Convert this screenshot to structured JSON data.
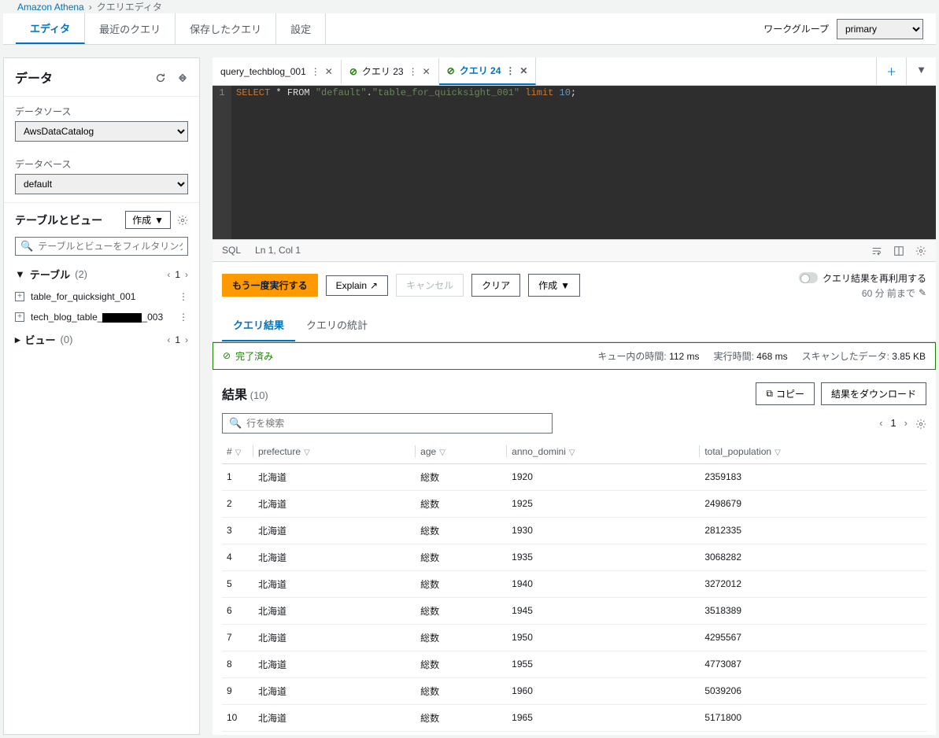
{
  "breadcrumb": {
    "service": "Amazon Athena",
    "page": "クエリエディタ"
  },
  "main_tabs": {
    "editor": "エディタ",
    "recent": "最近のクエリ",
    "saved": "保存したクエリ",
    "settings": "設定"
  },
  "workgroup": {
    "label": "ワークグループ",
    "value": "primary"
  },
  "data_panel": {
    "title": "データ",
    "datasource_label": "データソース",
    "datasource_value": "AwsDataCatalog",
    "database_label": "データベース",
    "database_value": "default",
    "tv_title": "テーブルとビュー",
    "create_btn": "作成",
    "filter_placeholder": "テーブルとビューをフィルタリング",
    "tables_label": "テーブル",
    "tables_count": "(2)",
    "tables_page": "1",
    "table_items": [
      "table_for_quicksight_001",
      "tech_blog_table_",
      "_003"
    ],
    "views_label": "ビュー",
    "views_count": "(0)",
    "views_page": "1"
  },
  "query_tabs": {
    "items": [
      {
        "label": "query_techblog_001",
        "check": false
      },
      {
        "label": "クエリ 23",
        "check": true
      },
      {
        "label": "クエリ 24",
        "check": true
      }
    ]
  },
  "editor": {
    "line_no": "1",
    "sql_select": "SELECT",
    "sql_from": " * FROM ",
    "sql_db": "\"default\"",
    "sql_dot": ".",
    "sql_table": "\"table_for_quicksight_001\"",
    "sql_limit": " limit ",
    "sql_num": "10",
    "sql_semi": ";"
  },
  "statusbar": {
    "lang": "SQL",
    "pos": "Ln 1, Col 1"
  },
  "toolbar": {
    "run": "もう一度実行する",
    "explain": "Explain",
    "cancel": "キャンセル",
    "clear": "クリア",
    "create": "作成",
    "reuse": "クエリ結果を再利用する",
    "reuse_age": "60 分 前まで"
  },
  "result_tabs": {
    "results": "クエリ結果",
    "stats": "クエリの統計"
  },
  "status": {
    "complete": "完了済み",
    "queue_label": "キュー内の時間:",
    "queue_val": "112 ms",
    "run_label": "実行時間:",
    "run_val": "468 ms",
    "scan_label": "スキャンしたデータ:",
    "scan_val": "3.85 KB"
  },
  "results": {
    "title": "結果",
    "count": "(10)",
    "copy": "コピー",
    "download": "結果をダウンロード",
    "filter_placeholder": "行を検索",
    "page": "1",
    "columns": [
      "#",
      "prefecture",
      "age",
      "anno_domini",
      "total_population"
    ],
    "rows": [
      [
        "1",
        "北海道",
        "総数",
        "1920",
        "2359183"
      ],
      [
        "2",
        "北海道",
        "総数",
        "1925",
        "2498679"
      ],
      [
        "3",
        "北海道",
        "総数",
        "1930",
        "2812335"
      ],
      [
        "4",
        "北海道",
        "総数",
        "1935",
        "3068282"
      ],
      [
        "5",
        "北海道",
        "総数",
        "1940",
        "3272012"
      ],
      [
        "6",
        "北海道",
        "総数",
        "1945",
        "3518389"
      ],
      [
        "7",
        "北海道",
        "総数",
        "1950",
        "4295567"
      ],
      [
        "8",
        "北海道",
        "総数",
        "1955",
        "4773087"
      ],
      [
        "9",
        "北海道",
        "総数",
        "1960",
        "5039206"
      ],
      [
        "10",
        "北海道",
        "総数",
        "1965",
        "5171800"
      ]
    ]
  }
}
